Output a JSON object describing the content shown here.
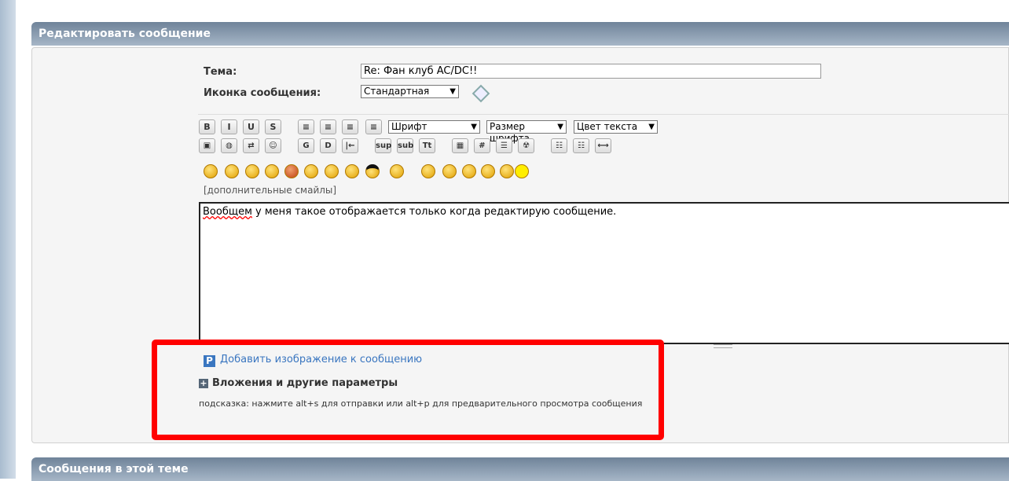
{
  "edit_header": "Редактировать сообщение",
  "subject": {
    "label": "Тема:",
    "value": "Re: Фан клуб AC/DC!!"
  },
  "icon": {
    "label": "Иконка сообщения:",
    "value": "Стандартная"
  },
  "toolbar": {
    "row1": [
      "B",
      "I",
      "U",
      "S",
      "≡",
      "≡",
      "≡",
      "≡"
    ],
    "font": "Шрифт",
    "size": "Размер шрифта",
    "color": "Цвет текста",
    "row2": [
      "▣",
      "◍",
      "⇄",
      "☺",
      "G",
      "D",
      "|←",
      "sup",
      "sub",
      "Tt",
      "▦",
      "#",
      "☰",
      "☢",
      "☷",
      "☷",
      "⟷"
    ]
  },
  "smilies_count": 16,
  "more_smilies": "[дополнительные смайлы]",
  "message": {
    "first_word": "Вообщем",
    "rest": " у меня такое отображается только когда редактирую сообщение."
  },
  "add_image": "Добавить изображение к сообщению",
  "add_image_icon": "P",
  "attachments": "Вложения и другие параметры",
  "hint": "подсказка: нажмите alt+s для отправки или alt+p для предварительного просмотра сообщения",
  "thread_header": "Сообщения в этой теме",
  "colors": {
    "highlight": "#ff0000",
    "link": "#3a76c0"
  }
}
